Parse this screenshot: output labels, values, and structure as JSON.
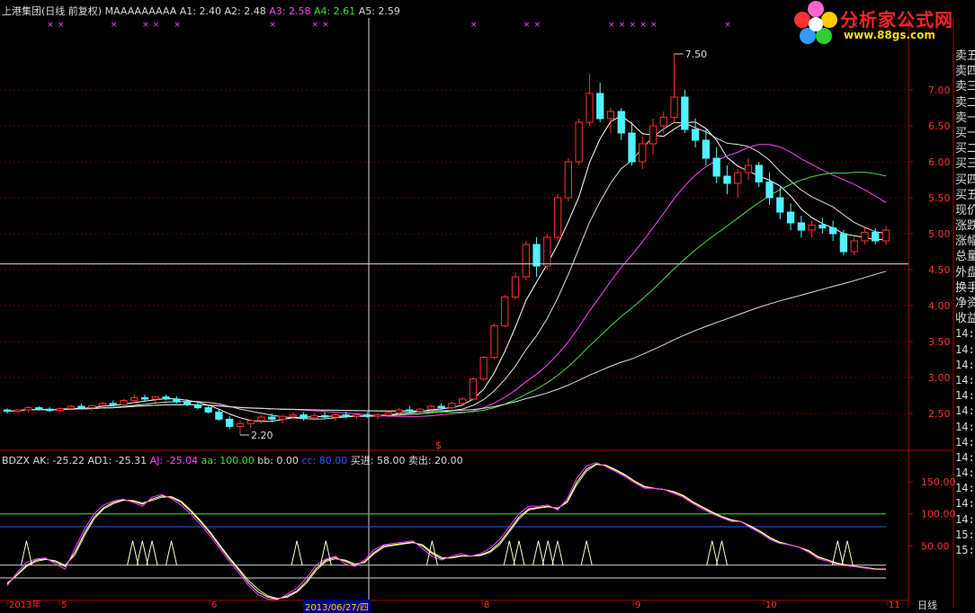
{
  "header_top": {
    "title": "上港集团(日线 前复权) MAAAAAAAAA",
    "items": [
      {
        "label": "A1:",
        "value": "2.40",
        "color": "#d9d9d9"
      },
      {
        "label": "A2:",
        "value": "2.48",
        "color": "#d9d9d9"
      },
      {
        "label": "A3:",
        "value": "2.58",
        "color": "#ff44ff"
      },
      {
        "label": "A4:",
        "value": "2.61",
        "color": "#44dd44"
      },
      {
        "label": "A5:",
        "value": "2.59",
        "color": "#d9d9d9"
      }
    ]
  },
  "header_bottom": {
    "title": "BDZX",
    "items": [
      {
        "label": "AK:",
        "value": "-25.22",
        "color": "#d9d9d9"
      },
      {
        "label": "AD1:",
        "value": "-25.31",
        "color": "#d9d9d9"
      },
      {
        "label": "AJ:",
        "value": "-25.04",
        "color": "#ff44ff"
      },
      {
        "label": "aa:",
        "value": "100.00",
        "color": "#44dd44"
      },
      {
        "label": "bb:",
        "value": "0.00",
        "color": "#d9d9d9"
      },
      {
        "label": "cc:",
        "value": "80.00",
        "color": "#3355ff"
      },
      {
        "label": "买进:",
        "value": "58.00",
        "color": "#d9d9d9"
      },
      {
        "label": "卖出:",
        "value": "20.00",
        "color": "#d9d9d9"
      }
    ]
  },
  "watermark": {
    "title": "分析家公式网",
    "url": "www.88gs.com"
  },
  "right_panel": {
    "labels": [
      "卖五",
      "卖四",
      "卖三",
      "卖二",
      "卖一",
      "买一",
      "买二",
      "买三",
      "买四",
      "买五",
      "现价",
      "涨跌",
      "涨幅",
      "总量",
      "外盘",
      "换手",
      "净资",
      "收益"
    ],
    "numbers": [
      "14:",
      "14:",
      "14:",
      "14:",
      "14:",
      "14:",
      "14:",
      "14:",
      "14:",
      "14:",
      "14:",
      "14:",
      "14:",
      "15:",
      "15:"
    ]
  },
  "date_label": "2013/06/27/四",
  "day_label": "日线",
  "bottom_axis_labels": [
    "2013年",
    "5",
    "6",
    "8",
    "9",
    "10",
    "11"
  ],
  "chart_data": [
    {
      "type": "candlestick",
      "title": "上港集团(日线 前复权)",
      "y_ticks": [
        2.5,
        3.0,
        3.5,
        4.0,
        4.5,
        5.0,
        5.5,
        6.0,
        6.5,
        7.0
      ],
      "ylim": [
        2.0,
        7.6
      ],
      "annotations": [
        {
          "text": "7.50",
          "value": 7.5
        },
        {
          "text": "2.20",
          "value": 2.2
        }
      ],
      "crosshair_price": 4.58,
      "series_colors": {
        "up": "#ff3030",
        "down": "#4ff3ff",
        "A1": "#ffffff",
        "A2": "#ffff66",
        "A3": "#ff44ff",
        "A4": "#44dd44",
        "A5": "#dddddd"
      },
      "candles": [
        [
          2.55,
          2.57,
          2.5,
          2.53
        ],
        [
          2.53,
          2.56,
          2.5,
          2.55
        ],
        [
          2.55,
          2.6,
          2.52,
          2.58
        ],
        [
          2.58,
          2.6,
          2.54,
          2.56
        ],
        [
          2.56,
          2.59,
          2.52,
          2.54
        ],
        [
          2.54,
          2.58,
          2.51,
          2.57
        ],
        [
          2.57,
          2.62,
          2.55,
          2.6
        ],
        [
          2.6,
          2.64,
          2.56,
          2.58
        ],
        [
          2.58,
          2.62,
          2.54,
          2.61
        ],
        [
          2.61,
          2.66,
          2.58,
          2.64
        ],
        [
          2.64,
          2.68,
          2.6,
          2.62
        ],
        [
          2.62,
          2.7,
          2.6,
          2.68
        ],
        [
          2.68,
          2.76,
          2.64,
          2.72
        ],
        [
          2.72,
          2.76,
          2.66,
          2.7
        ],
        [
          2.7,
          2.74,
          2.65,
          2.73
        ],
        [
          2.73,
          2.76,
          2.68,
          2.7
        ],
        [
          2.7,
          2.74,
          2.64,
          2.66
        ],
        [
          2.66,
          2.7,
          2.6,
          2.62
        ],
        [
          2.62,
          2.66,
          2.56,
          2.58
        ],
        [
          2.58,
          2.62,
          2.5,
          2.52
        ],
        [
          2.52,
          2.56,
          2.4,
          2.42
        ],
        [
          2.42,
          2.46,
          2.28,
          2.32
        ],
        [
          2.32,
          2.4,
          2.2,
          2.36
        ],
        [
          2.36,
          2.42,
          2.3,
          2.4
        ],
        [
          2.4,
          2.48,
          2.36,
          2.45
        ],
        [
          2.45,
          2.5,
          2.38,
          2.42
        ],
        [
          2.42,
          2.48,
          2.36,
          2.46
        ],
        [
          2.46,
          2.52,
          2.42,
          2.48
        ],
        [
          2.48,
          2.52,
          2.4,
          2.44
        ],
        [
          2.44,
          2.5,
          2.4,
          2.47
        ],
        [
          2.47,
          2.52,
          2.42,
          2.45
        ],
        [
          2.45,
          2.5,
          2.4,
          2.48
        ],
        [
          2.48,
          2.52,
          2.43,
          2.46
        ],
        [
          2.46,
          2.5,
          2.42,
          2.48
        ],
        [
          2.48,
          2.52,
          2.44,
          2.46
        ],
        [
          2.46,
          2.5,
          2.42,
          2.48
        ],
        [
          2.48,
          2.53,
          2.45,
          2.51
        ],
        [
          2.51,
          2.58,
          2.48,
          2.55
        ],
        [
          2.55,
          2.6,
          2.5,
          2.53
        ],
        [
          2.53,
          2.58,
          2.5,
          2.56
        ],
        [
          2.56,
          2.62,
          2.52,
          2.6
        ],
        [
          2.6,
          2.64,
          2.55,
          2.58
        ],
        [
          2.58,
          2.66,
          2.56,
          2.64
        ],
        [
          2.64,
          2.72,
          2.6,
          2.7
        ],
        [
          2.7,
          3.0,
          2.68,
          2.98
        ],
        [
          2.98,
          3.3,
          2.95,
          3.28
        ],
        [
          3.28,
          3.75,
          3.25,
          3.72
        ],
        [
          3.72,
          4.15,
          3.7,
          4.12
        ],
        [
          4.12,
          4.45,
          4.08,
          4.4
        ],
        [
          4.4,
          4.9,
          4.35,
          4.85
        ],
        [
          4.85,
          4.95,
          4.4,
          4.55
        ],
        [
          4.55,
          5.0,
          4.5,
          4.95
        ],
        [
          4.95,
          5.55,
          4.9,
          5.5
        ],
        [
          5.5,
          6.05,
          5.45,
          6.0
        ],
        [
          6.0,
          6.6,
          5.95,
          6.55
        ],
        [
          6.55,
          7.22,
          6.5,
          6.95
        ],
        [
          6.95,
          7.1,
          6.55,
          6.6
        ],
        [
          6.6,
          6.75,
          6.4,
          6.7
        ],
        [
          6.7,
          6.75,
          6.3,
          6.4
        ],
        [
          6.4,
          6.55,
          5.95,
          6.0
        ],
        [
          6.0,
          6.35,
          5.9,
          6.25
        ],
        [
          6.25,
          6.6,
          6.1,
          6.5
        ],
        [
          6.5,
          6.7,
          6.4,
          6.62
        ],
        [
          6.62,
          7.5,
          6.55,
          6.9
        ],
        [
          6.9,
          7.0,
          6.4,
          6.45
        ],
        [
          6.45,
          6.6,
          6.2,
          6.3
        ],
        [
          6.3,
          6.45,
          5.95,
          6.05
        ],
        [
          6.05,
          6.2,
          5.7,
          5.8
        ],
        [
          5.8,
          5.95,
          5.55,
          5.7
        ],
        [
          5.7,
          5.9,
          5.5,
          5.85
        ],
        [
          5.85,
          6.05,
          5.75,
          5.95
        ],
        [
          5.95,
          6.0,
          5.65,
          5.72
        ],
        [
          5.72,
          5.85,
          5.4,
          5.5
        ],
        [
          5.5,
          5.65,
          5.2,
          5.3
        ],
        [
          5.3,
          5.42,
          5.05,
          5.15
        ],
        [
          5.15,
          5.25,
          4.95,
          5.05
        ],
        [
          5.05,
          5.18,
          4.95,
          5.12
        ],
        [
          5.12,
          5.22,
          5.0,
          5.08
        ],
        [
          5.08,
          5.18,
          4.9,
          5.0
        ],
        [
          5.0,
          5.05,
          4.7,
          4.75
        ],
        [
          4.75,
          4.95,
          4.7,
          4.9
        ],
        [
          4.9,
          5.08,
          4.85,
          5.02
        ],
        [
          5.02,
          5.08,
          4.85,
          4.9
        ],
        [
          4.9,
          5.1,
          4.85,
          5.05
        ]
      ]
    },
    {
      "type": "line",
      "title": "BDZX",
      "y_ticks": [
        50.0,
        100.0,
        150.0
      ],
      "ylim": [
        -35,
        195
      ],
      "levels": {
        "aa": 100,
        "bb": 0,
        "cc": 80,
        "buy": 58,
        "sell": 20
      },
      "series": [
        {
          "name": "AK",
          "color": "#ffffff",
          "values": [
            -10,
            5,
            20,
            28,
            30,
            25,
            18,
            40,
            70,
            95,
            110,
            118,
            122,
            120,
            115,
            123,
            128,
            126,
            118,
            104,
            88,
            70,
            50,
            30,
            12,
            -8,
            -22,
            -30,
            -33,
            -28,
            -20,
            -5,
            15,
            28,
            32,
            26,
            20,
            25,
            40,
            50,
            52,
            54,
            56,
            50,
            38,
            30,
            32,
            35,
            34,
            36,
            42,
            55,
            75,
            95,
            108,
            110,
            112,
            108,
            120,
            150,
            170,
            178,
            175,
            168,
            160,
            150,
            142,
            140,
            138,
            134,
            128,
            118,
            110,
            102,
            95,
            90,
            88,
            80,
            72,
            62,
            55,
            52,
            48,
            42,
            32,
            28,
            22,
            20,
            18,
            16,
            14,
            14
          ]
        },
        {
          "name": "AD1",
          "color": "#ffff66",
          "values": [
            -8,
            4,
            18,
            26,
            29,
            27,
            20,
            36,
            66,
            92,
            108,
            116,
            121,
            121,
            117,
            121,
            126,
            127,
            120,
            106,
            90,
            72,
            52,
            32,
            14,
            -4,
            -18,
            -28,
            -32,
            -30,
            -22,
            -8,
            12,
            26,
            30,
            28,
            22,
            24,
            38,
            48,
            51,
            53,
            55,
            52,
            40,
            32,
            31,
            34,
            34,
            35,
            40,
            52,
            72,
            92,
            106,
            109,
            111,
            109,
            118,
            146,
            167,
            177,
            176,
            169,
            161,
            151,
            143,
            140,
            138,
            135,
            129,
            119,
            111,
            103,
            96,
            91,
            88,
            81,
            73,
            63,
            56,
            52,
            48,
            43,
            33,
            28,
            23,
            20,
            18,
            16,
            14,
            14
          ]
        },
        {
          "name": "AJ",
          "color": "#ff44ff",
          "values": [
            -12,
            8,
            24,
            30,
            31,
            22,
            14,
            46,
            76,
            100,
            114,
            120,
            123,
            118,
            112,
            126,
            130,
            124,
            114,
            100,
            84,
            66,
            46,
            26,
            8,
            -12,
            -26,
            -33,
            -34,
            -25,
            -16,
            0,
            20,
            30,
            34,
            22,
            18,
            28,
            44,
            52,
            54,
            56,
            58,
            46,
            34,
            28,
            34,
            38,
            34,
            38,
            46,
            60,
            80,
            100,
            112,
            112,
            114,
            106,
            124,
            156,
            175,
            180,
            174,
            166,
            158,
            148,
            140,
            140,
            138,
            132,
            126,
            116,
            108,
            100,
            94,
            88,
            88,
            78,
            70,
            60,
            54,
            52,
            48,
            40,
            30,
            26,
            20,
            19,
            17,
            15,
            13,
            13
          ]
        }
      ],
      "buy_signal_indices": [
        2,
        13,
        14,
        15,
        17,
        30,
        33,
        44,
        52,
        53,
        55,
        56,
        57,
        60,
        73,
        74,
        86,
        87
      ]
    }
  ]
}
